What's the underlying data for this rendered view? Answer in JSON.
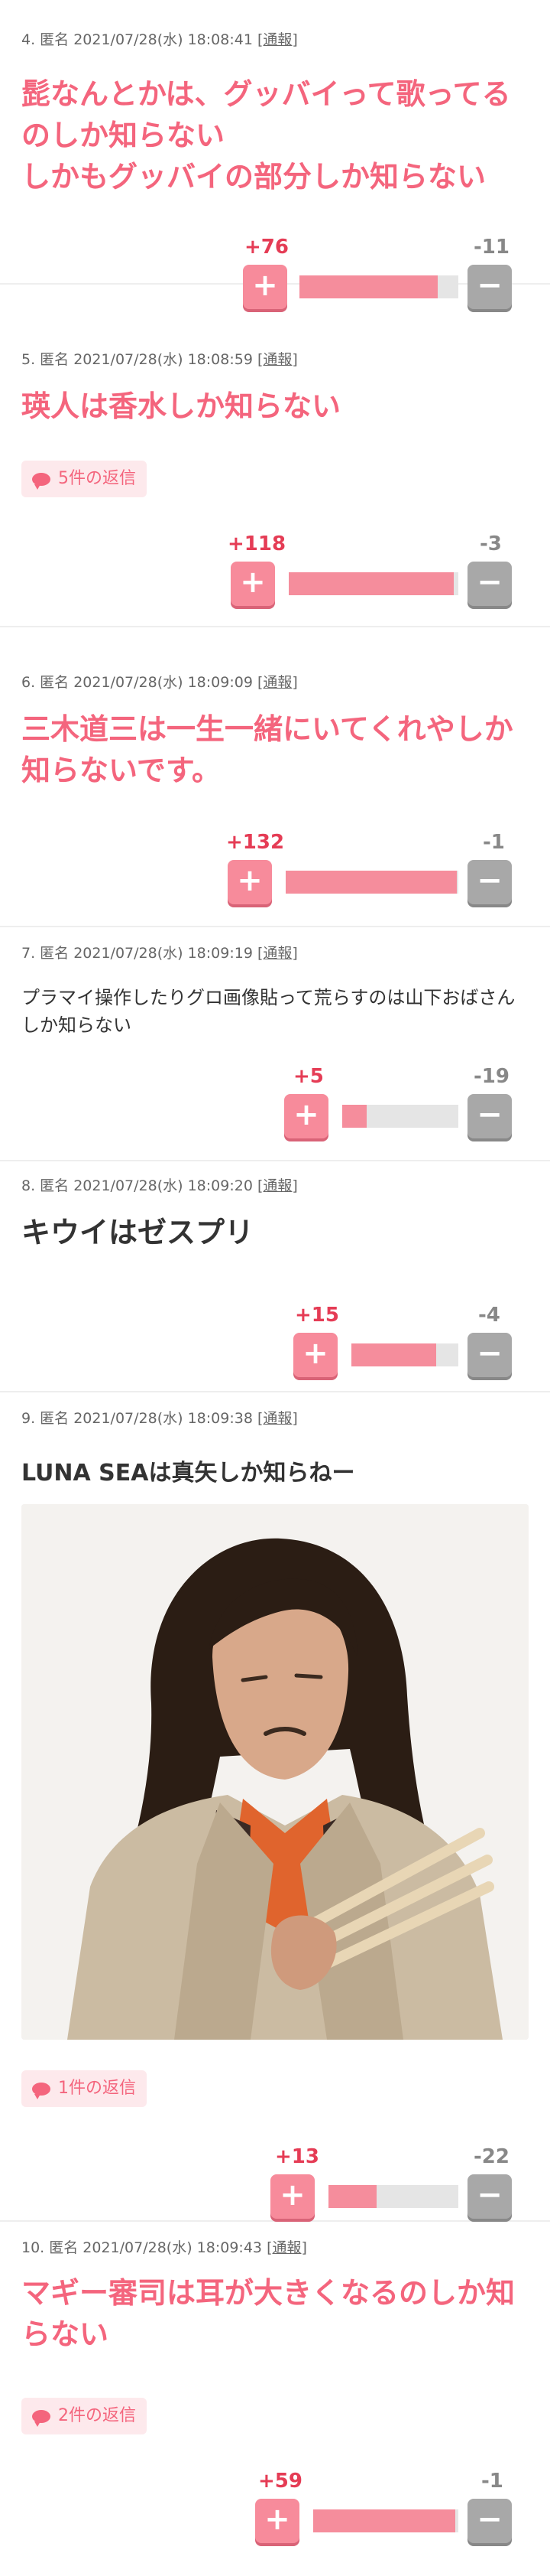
{
  "comments": [
    {
      "meta": "4. 匿名 2021/07/28(水) 18:08:41",
      "report": "[通報]",
      "text": "髭なんとかは、グッバイって歌ってるのしか知らない\nしかもグッバイの部分しか知らない",
      "plus": "+76",
      "minus": "-11",
      "ratio": 0.87
    },
    {
      "meta": "5. 匿名 2021/07/28(水) 18:08:59",
      "report": "[通報]",
      "text": "瑛人は香水しか知らない",
      "reply": "5件の返信",
      "plus": "+118",
      "minus": "-3",
      "ratio": 0.975
    },
    {
      "meta": "6. 匿名 2021/07/28(水) 18:09:09",
      "report": "[通報]",
      "text": "三木道三は一生一緒にいてくれやしか知らないです。",
      "plus": "+132",
      "minus": "-1",
      "ratio": 0.99
    },
    {
      "meta": "7. 匿名 2021/07/28(水) 18:09:19",
      "report": "[通報]",
      "text": "プラマイ操作したりグロ画像貼って荒らすのは山下おばさんしか知らない",
      "plus": "+5",
      "minus": "-19",
      "ratio": 0.21
    },
    {
      "meta": "8. 匿名 2021/07/28(水) 18:09:20",
      "report": "[通報]",
      "text": "キウイはゼスプリ",
      "plus": "+15",
      "minus": "-4",
      "ratio": 0.79
    },
    {
      "meta": "9. 匿名 2021/07/28(水) 18:09:38",
      "report": "[通報]",
      "text": "LUNA SEAは真矢しか知らねー",
      "reply": "1件の返信",
      "plus": "+13",
      "minus": "-22",
      "ratio": 0.37
    },
    {
      "meta": "10. 匿名 2021/07/28(水) 18:09:43",
      "report": "[通報]",
      "text": "マギー審司は耳が大きくなるのしか知らない",
      "reply": "2件の返信",
      "plus": "+59",
      "minus": "-1",
      "ratio": 0.98
    }
  ],
  "icons": {
    "plus": "+",
    "minus": "−"
  },
  "colors": {
    "accent": "#f4657d",
    "plus_button": "#f78b9b",
    "minus_button": "#a8a8a8",
    "bar_fill": "#f58d9c"
  }
}
